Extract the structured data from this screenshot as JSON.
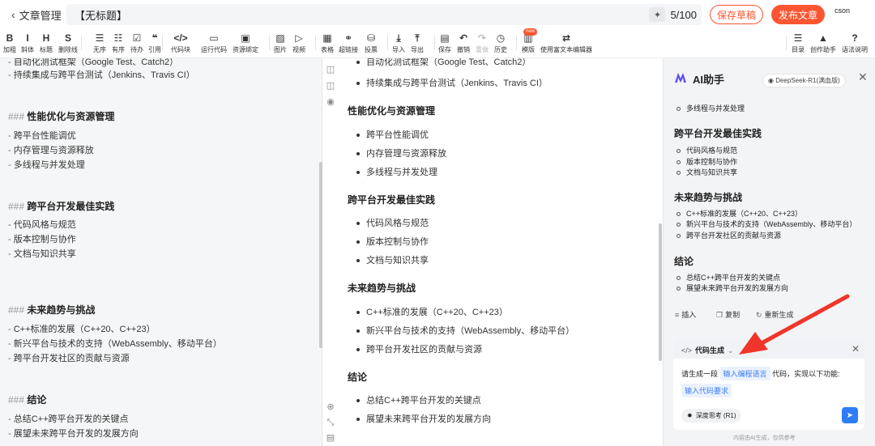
{
  "header": {
    "back_label": "文章管理",
    "title": "【无标题】",
    "title_count": "5/100",
    "save_draft": "保存草稿",
    "publish": "发布文章",
    "avatar_text": "cson"
  },
  "toolbar": {
    "items": [
      {
        "icon": "B",
        "label": "加粗"
      },
      {
        "icon": "I",
        "label": "斜体"
      },
      {
        "icon": "H",
        "label": "标题"
      },
      {
        "icon": "S",
        "label": "删除线"
      },
      {
        "icon": "☰",
        "label": "无序"
      },
      {
        "icon": "☷",
        "label": "有序"
      },
      {
        "icon": "☑",
        "label": "待办"
      },
      {
        "icon": "❝",
        "label": "引用"
      },
      {
        "icon": "</>",
        "label": "代码块"
      },
      {
        "icon": "▭",
        "label": "运行代码"
      },
      {
        "icon": "▣",
        "label": "资源绑定"
      },
      {
        "icon": "▨",
        "label": "图片"
      },
      {
        "icon": "▷",
        "label": "视频"
      },
      {
        "icon": "▦",
        "label": "表格"
      },
      {
        "icon": "⚭",
        "label": "超链接"
      },
      {
        "icon": "⛁",
        "label": "投票"
      },
      {
        "icon": "⤓",
        "label": "导入"
      },
      {
        "icon": "⤒",
        "label": "导出"
      },
      {
        "icon": "▤",
        "label": "保存"
      },
      {
        "icon": "↶",
        "label": "撤销"
      },
      {
        "icon": "↷",
        "label": "重做"
      },
      {
        "icon": "◷",
        "label": "历史"
      },
      {
        "icon": "▥",
        "label": "模版",
        "badge": "new"
      },
      {
        "icon": "⇄",
        "label": "使用富文本编辑器"
      },
      {
        "icon": "☰",
        "label": "目录"
      },
      {
        "icon": "▲",
        "label": "创作助手"
      },
      {
        "icon": "?",
        "label": "语法说明"
      }
    ]
  },
  "editor": {
    "lines": [
      {
        "type": "li",
        "text": "自动化测试框架（Google Test、Catch2）"
      },
      {
        "type": "li",
        "text": "持续集成与跨平台测试（Jenkins、Travis CI）"
      },
      {
        "type": "h3",
        "hash": "###",
        "text": "性能优化与资源管理"
      },
      {
        "type": "li",
        "text": "跨平台性能调优"
      },
      {
        "type": "li",
        "text": "内存管理与资源释放"
      },
      {
        "type": "li",
        "text": "多线程与并发处理"
      },
      {
        "type": "h3",
        "hash": "###",
        "text": "跨平台开发最佳实践"
      },
      {
        "type": "li",
        "text": "代码风格与规范"
      },
      {
        "type": "li",
        "text": "版本控制与协作"
      },
      {
        "type": "li",
        "text": "文档与知识共享"
      },
      {
        "type": "h3",
        "hash": "###",
        "text": "未来趋势与挑战"
      },
      {
        "type": "li",
        "text": "C++标准的发展（C++20、C++23）"
      },
      {
        "type": "li",
        "text": "新兴平台与技术的支持（WebAssembly、移动平台）"
      },
      {
        "type": "li",
        "text": "跨平台开发社区的贡献与资源"
      },
      {
        "type": "h3",
        "hash": "###",
        "text": "结论"
      },
      {
        "type": "li",
        "text": "总结C++跨平台开发的关键点"
      },
      {
        "type": "li",
        "text": "展望未来跨平台开发的发展方向"
      }
    ]
  },
  "preview": {
    "lines": [
      {
        "type": "li",
        "text": "自动化测试框架（Google Test、Catch2）"
      },
      {
        "type": "li",
        "text": "持续集成与跨平台测试（Jenkins、Travis CI）"
      },
      {
        "type": "h",
        "text": "性能优化与资源管理"
      },
      {
        "type": "li",
        "text": "跨平台性能调优"
      },
      {
        "type": "li",
        "text": "内存管理与资源释放"
      },
      {
        "type": "li",
        "text": "多线程与并发处理"
      },
      {
        "type": "h",
        "text": "跨平台开发最佳实践"
      },
      {
        "type": "li",
        "text": "代码风格与规范"
      },
      {
        "type": "li",
        "text": "版本控制与协作"
      },
      {
        "type": "li",
        "text": "文档与知识共享"
      },
      {
        "type": "h",
        "text": "未来趋势与挑战"
      },
      {
        "type": "li",
        "text": "C++标准的发展（C++20、C++23）"
      },
      {
        "type": "li",
        "text": "新兴平台与技术的支持（WebAssembly、移动平台）"
      },
      {
        "type": "li",
        "text": "跨平台开发社区的贡献与资源"
      },
      {
        "type": "h",
        "text": "结论"
      },
      {
        "type": "li",
        "text": "总结C++跨平台开发的关键点"
      },
      {
        "type": "li",
        "text": "展望未来跨平台开发的发展方向"
      }
    ]
  },
  "ai": {
    "title": "AI助手",
    "model": "DeepSeek-R1(满血版)",
    "content": [
      {
        "type": "li",
        "text": "多线程与并发处理"
      },
      {
        "type": "h",
        "text": "跨平台开发最佳实践"
      },
      {
        "type": "li",
        "text": "代码风格与规范"
      },
      {
        "type": "li",
        "text": "版本控制与协作"
      },
      {
        "type": "li",
        "text": "文档与知识共享"
      },
      {
        "type": "h",
        "text": "未来趋势与挑战"
      },
      {
        "type": "li",
        "text": "C++标准的发展（C++20、C++23）"
      },
      {
        "type": "li",
        "text": "新兴平台与技术的支持（WebAssembly、移动平台）"
      },
      {
        "type": "li",
        "text": "跨平台开发社区的贡献与资源"
      },
      {
        "type": "h",
        "text": "结论"
      },
      {
        "type": "li",
        "text": "总结C++跨平台开发的关键点"
      },
      {
        "type": "li",
        "text": "展望未来跨平台开发的发展方向"
      }
    ],
    "actions": {
      "insert": "插入",
      "copy": "复制",
      "regenerate": "重新生成"
    },
    "code_card": {
      "title": "代码生成",
      "prompt_prefix": "请生成一段",
      "lang_placeholder": "输入编程语言",
      "prompt_suffix": "代码，实现以下功能:",
      "req_placeholder": "输入代码要求",
      "deep_think": "深度思考 (R1)"
    },
    "footer": "内容由AI生成，仅供参考"
  },
  "colors": {
    "brand": "#fc5531",
    "accent_blue": "#2e7cf6",
    "arrow": "#f0352a"
  }
}
